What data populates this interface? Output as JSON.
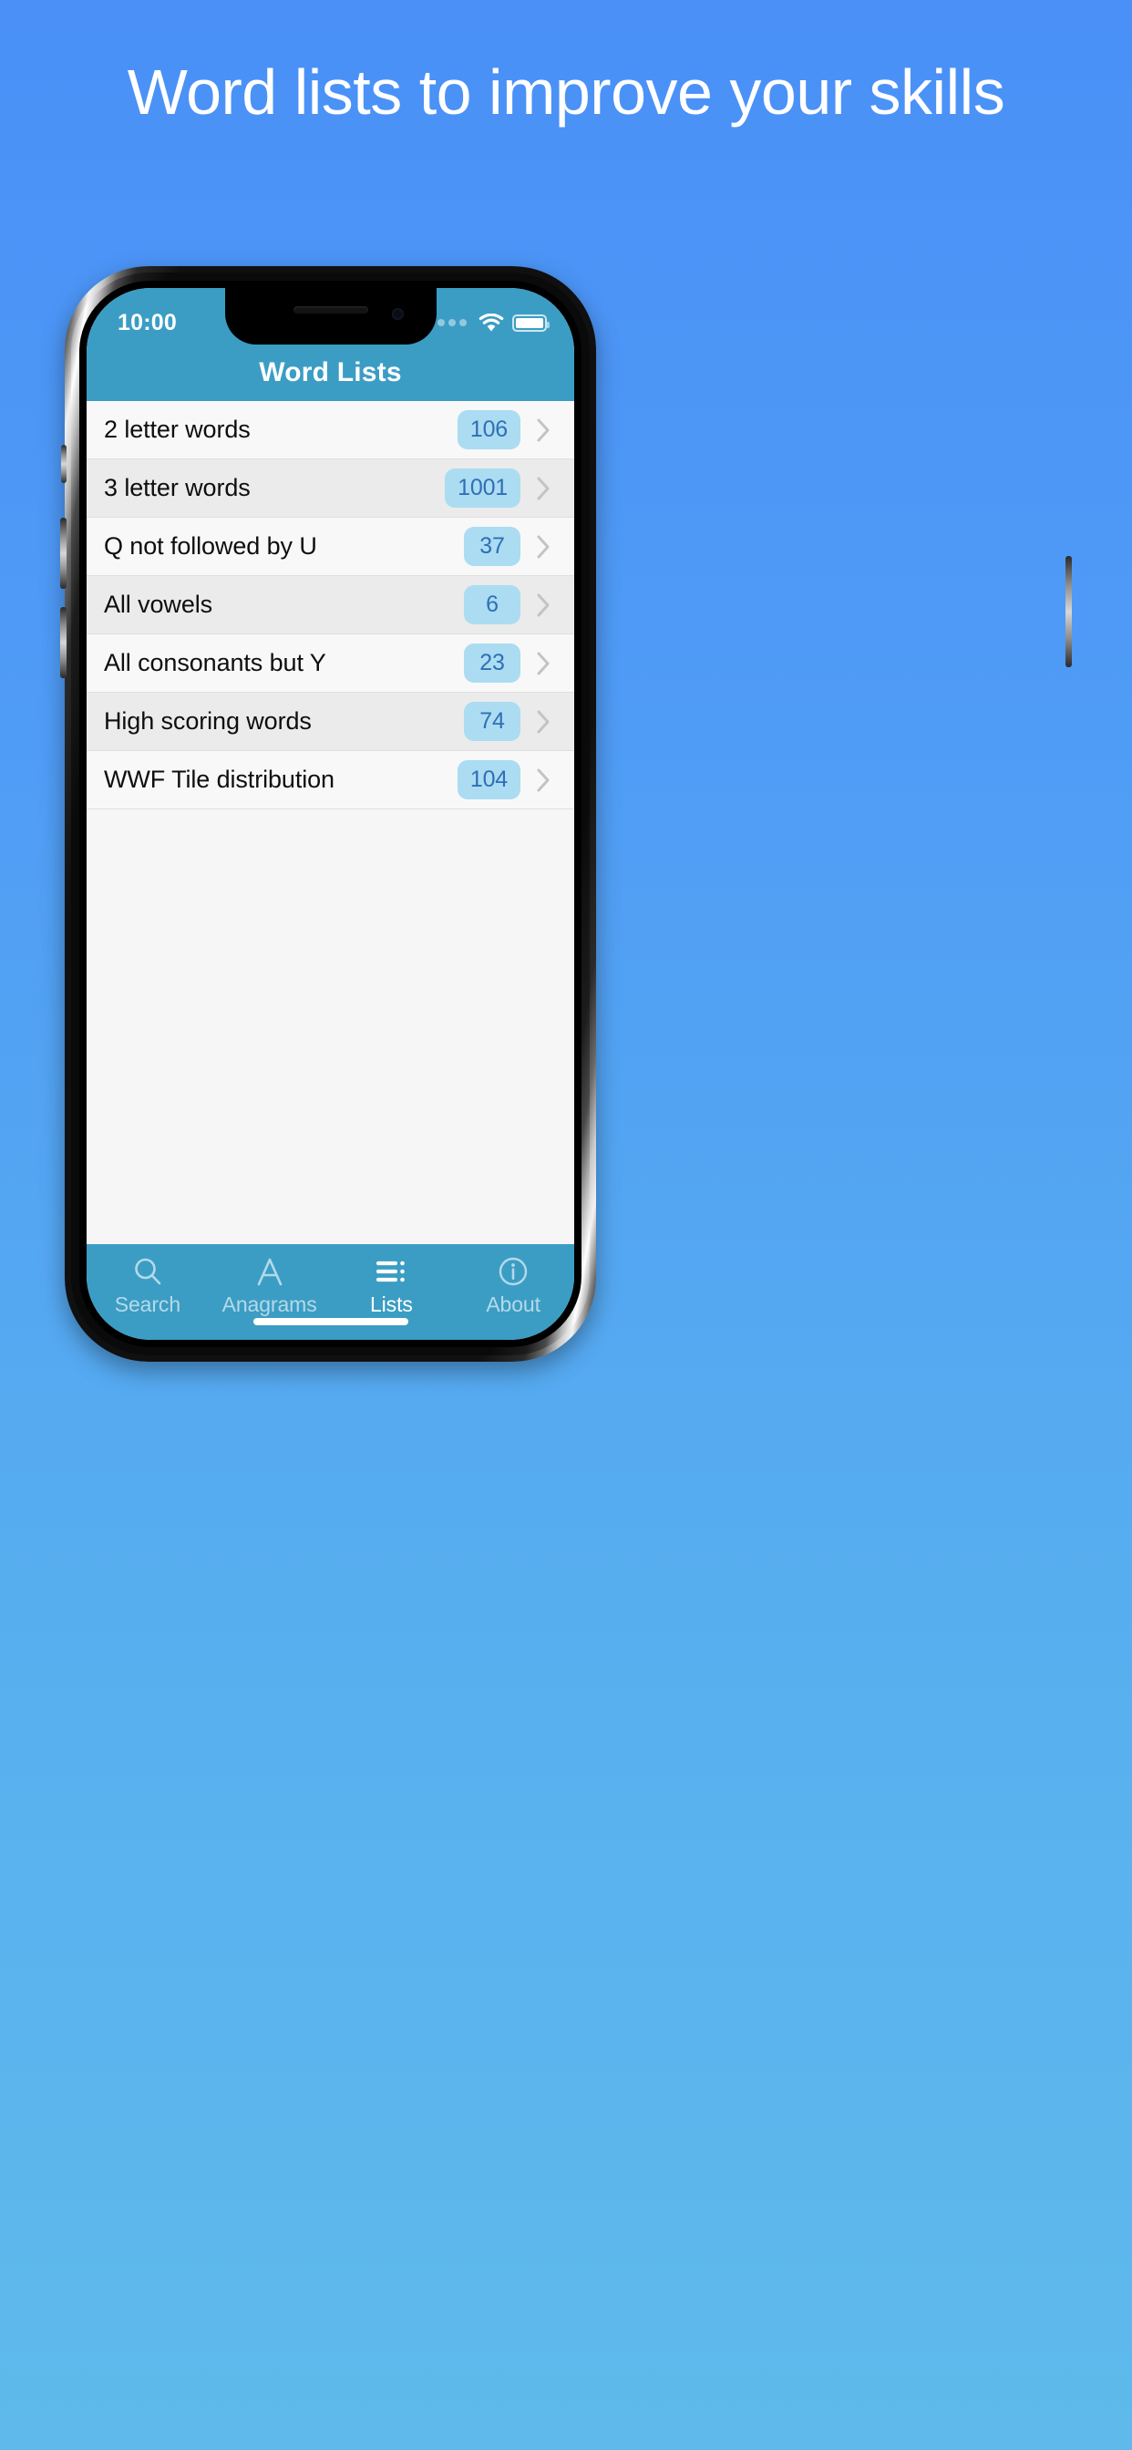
{
  "promo": {
    "headline": "Word lists to improve your skills"
  },
  "colors": {
    "background_top": "#4a90f7",
    "background_bottom": "#5fbaeb",
    "app_chrome": "#3b9dc4",
    "badge_background": "#abdcf2",
    "badge_text": "#2f6fb5",
    "row_odd": "#f8f8f8",
    "row_even": "#ebebeb"
  },
  "statusbar": {
    "time": "10:00",
    "signal_icon": "signal-dots-icon",
    "wifi_icon": "wifi-icon",
    "battery_icon": "battery-full-icon"
  },
  "navbar": {
    "title": "Word Lists"
  },
  "list": {
    "rows": [
      {
        "label": "2 letter words",
        "count": "106",
        "chevron": "chevron-right-icon"
      },
      {
        "label": "3 letter words",
        "count": "1001",
        "chevron": "chevron-right-icon"
      },
      {
        "label": "Q not followed by U",
        "count": "37",
        "chevron": "chevron-right-icon"
      },
      {
        "label": "All vowels",
        "count": "6",
        "chevron": "chevron-right-icon"
      },
      {
        "label": "All consonants but Y",
        "count": "23",
        "chevron": "chevron-right-icon"
      },
      {
        "label": "High scoring words",
        "count": "74",
        "chevron": "chevron-right-icon"
      },
      {
        "label": "WWF Tile distribution",
        "count": "104",
        "chevron": "chevron-right-icon"
      }
    ]
  },
  "tabbar": {
    "tabs": [
      {
        "label": "Search",
        "icon": "magnifier-icon",
        "active": false
      },
      {
        "label": "Anagrams",
        "icon": "letter-a-icon",
        "active": false
      },
      {
        "label": "Lists",
        "icon": "list-lines-icon",
        "active": true
      },
      {
        "label": "About",
        "icon": "info-circle-icon",
        "active": false
      }
    ]
  }
}
